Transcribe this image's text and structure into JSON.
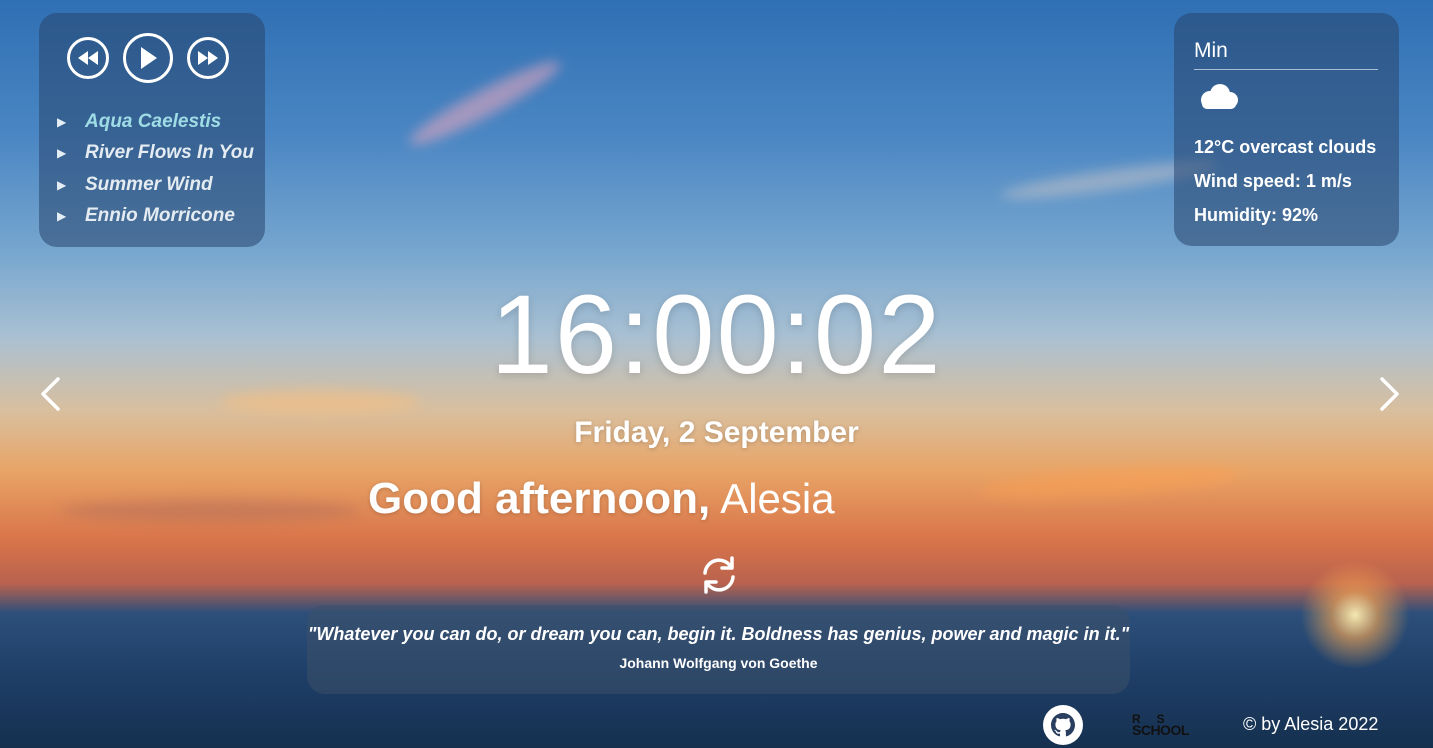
{
  "player": {
    "icons": {
      "prev": "rewind-icon",
      "play": "play-icon",
      "next": "fast-forward-icon"
    },
    "playlist": [
      {
        "title": "Aqua Caelestis",
        "active": true
      },
      {
        "title": "River Flows In You",
        "active": false
      },
      {
        "title": "Summer Wind",
        "active": false
      },
      {
        "title": "Ennio Morricone",
        "active": false
      }
    ],
    "active_color": "#9fdde6"
  },
  "weather": {
    "city": "Min",
    "icon": "cloud-icon",
    "temp_line": "12°C  overcast clouds",
    "wind_line": "Wind speed: 1 m/s",
    "humidity_line": "Humidity: 92%"
  },
  "clock": {
    "time": "16:00:02",
    "date": "Friday, 2 September"
  },
  "greeting": {
    "text": "Good afternoon,",
    "name": "Alesia"
  },
  "quote": {
    "text": "\"Whatever you can do, or dream you can, begin it. Boldness has genius, power and magic in it.\"",
    "author": "Johann Wolfgang von Goethe"
  },
  "footer": {
    "github_icon": "github-icon",
    "rs_logo": "RS SCHOOL",
    "copyright": "© by Alesia 2022"
  }
}
